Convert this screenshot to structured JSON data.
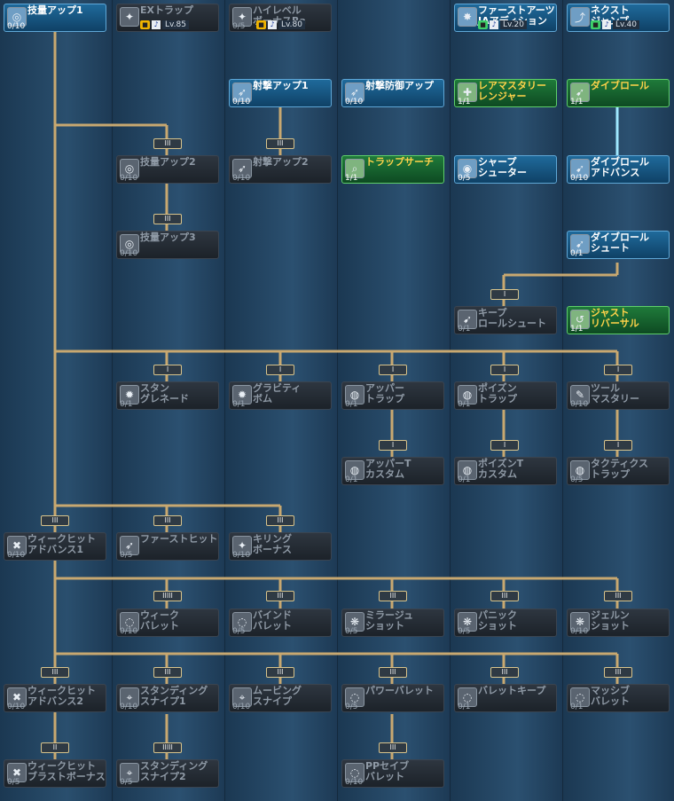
{
  "colors": {
    "line": "#c8a870",
    "learned": "#1f6a9b",
    "green": "#1f7a3a",
    "locked": "#2a323c",
    "gold_text": "#ffd24a"
  },
  "skills": [
    {
      "name": "技量アップ1",
      "lv": "0/10",
      "state": "learned",
      "icon": "target"
    },
    {
      "name": "EXトラップ",
      "lv": "",
      "state": "locked",
      "icon": "trap",
      "req": {
        "lock": "gold",
        "text": "Lv.85"
      }
    },
    {
      "name": "ハイレベル\nボーナスRa",
      "lv": "0/5",
      "state": "locked",
      "icon": "bonus",
      "req": {
        "lock": "gold",
        "text": "Lv.80"
      }
    },
    {
      "name": "ファーストアーツ\nJAアディション",
      "lv": "",
      "state": "learned",
      "icon": "arts",
      "req": {
        "lock": "green",
        "text": "Lv.20"
      }
    },
    {
      "name": "ネクスト\nジャンプ",
      "lv": "",
      "state": "learned",
      "icon": "jump",
      "req": {
        "lock": "green",
        "text": "Lv.40"
      }
    },
    {
      "name": "射撃アップ1",
      "lv": "0/10",
      "state": "learned",
      "icon": "shoot"
    },
    {
      "name": "射撃防御アップ",
      "lv": "0/10",
      "state": "learned",
      "icon": "guard"
    },
    {
      "name": "レアマスタリー\nレンジャー",
      "lv": "1/1",
      "state": "green",
      "icon": "rare"
    },
    {
      "name": "ダイブロール",
      "lv": "1/1",
      "state": "green",
      "icon": "dive"
    },
    {
      "name": "技量アップ2",
      "lv": "0/10",
      "state": "locked",
      "icon": "target"
    },
    {
      "name": "射撃アップ2",
      "lv": "0/10",
      "state": "locked",
      "icon": "shoot"
    },
    {
      "name": "トラップサーチ",
      "lv": "1/1",
      "state": "green",
      "icon": "search"
    },
    {
      "name": "シャープ\nシューター",
      "lv": "0/5",
      "state": "learned",
      "icon": "sharp"
    },
    {
      "name": "ダイブロール\nアドバンス",
      "lv": "0/10",
      "state": "learned",
      "icon": "dive"
    },
    {
      "name": "技量アップ3",
      "lv": "0/10",
      "state": "locked",
      "icon": "target"
    },
    {
      "name": "ダイブロール\nシュート",
      "lv": "0/1",
      "state": "learned",
      "icon": "dive"
    },
    {
      "name": "キープ\nロールシュート",
      "lv": "0/1",
      "state": "locked",
      "icon": "dive"
    },
    {
      "name": "ジャスト\nリバーサル",
      "lv": "1/1",
      "state": "green",
      "icon": "reverse"
    },
    {
      "name": "スタン\nグレネード",
      "lv": "0/1",
      "state": "locked",
      "icon": "grenade"
    },
    {
      "name": "グラビティ\nボム",
      "lv": "0/1",
      "state": "locked",
      "icon": "bomb"
    },
    {
      "name": "アッパー\nトラップ",
      "lv": "0/1",
      "state": "locked",
      "icon": "trap"
    },
    {
      "name": "ポイズン\nトラップ",
      "lv": "0/1",
      "state": "locked",
      "icon": "trap"
    },
    {
      "name": "ツール\nマスタリー",
      "lv": "0/10",
      "state": "locked",
      "icon": "tool"
    },
    {
      "name": "アッパーT\nカスタム",
      "lv": "0/1",
      "state": "locked",
      "icon": "trap"
    },
    {
      "name": "ポイズンT\nカスタム",
      "lv": "0/1",
      "state": "locked",
      "icon": "trap"
    },
    {
      "name": "タクティクス\nトラップ",
      "lv": "0/5",
      "state": "locked",
      "icon": "trap"
    },
    {
      "name": "ウィークヒット\nアドバンス1",
      "lv": "0/10",
      "state": "locked",
      "icon": "weak"
    },
    {
      "name": "ファーストヒット",
      "lv": "0/5",
      "state": "locked",
      "icon": "first"
    },
    {
      "name": "キリング\nボーナス",
      "lv": "0/10",
      "state": "locked",
      "icon": "kill"
    },
    {
      "name": "ウィーク\nバレット",
      "lv": "0/10",
      "state": "locked",
      "icon": "bullet"
    },
    {
      "name": "バインド\nバレット",
      "lv": "0/5",
      "state": "locked",
      "icon": "bullet"
    },
    {
      "name": "ミラージュ\nショット",
      "lv": "0/5",
      "state": "locked",
      "icon": "shot"
    },
    {
      "name": "パニック\nショット",
      "lv": "0/5",
      "state": "locked",
      "icon": "shot"
    },
    {
      "name": "ジェルン\nショット",
      "lv": "0/10",
      "state": "locked",
      "icon": "shot"
    },
    {
      "name": "ウィークヒット\nアドバンス2",
      "lv": "0/10",
      "state": "locked",
      "icon": "weak"
    },
    {
      "name": "スタンディング\nスナイプ1",
      "lv": "0/10",
      "state": "locked",
      "icon": "snipe"
    },
    {
      "name": "ムービング\nスナイプ",
      "lv": "0/10",
      "state": "locked",
      "icon": "snipe"
    },
    {
      "name": "パワーバレット",
      "lv": "0/5",
      "state": "locked",
      "icon": "bullet"
    },
    {
      "name": "バレットキープ",
      "lv": "0/1",
      "state": "locked",
      "icon": "bullet"
    },
    {
      "name": "マッシブ\nバレット",
      "lv": "0/1",
      "state": "locked",
      "icon": "bullet"
    },
    {
      "name": "ウィークヒット\nブラストボーナス",
      "lv": "0/5",
      "state": "locked",
      "icon": "weak"
    },
    {
      "name": "スタンディング\nスナイプ2",
      "lv": "0/5",
      "state": "locked",
      "icon": "snipe"
    },
    {
      "name": "PPセイブ\nバレット",
      "lv": "0/10",
      "state": "locked",
      "icon": "bullet"
    }
  ],
  "nodes": [
    "III",
    "III",
    "III",
    "I",
    "I",
    "I",
    "I",
    "I",
    "I",
    "I",
    "I",
    "III",
    "III",
    "III",
    "IIIII",
    "III",
    "III",
    "III",
    "III",
    "III",
    "III",
    "IIIII",
    "III",
    "III",
    "III",
    "III",
    "II",
    "IIIII",
    "III"
  ]
}
